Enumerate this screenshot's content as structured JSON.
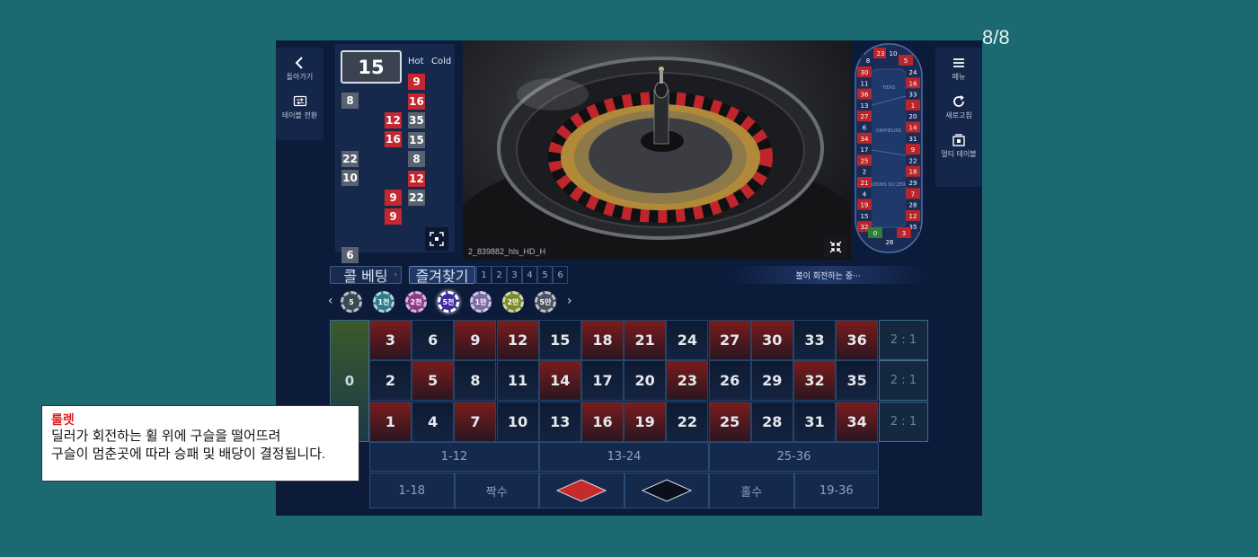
{
  "page_counter": "8/8",
  "left_menu": {
    "back_label": "돌아가기",
    "switch_label": "테이블 전환"
  },
  "right_menu": {
    "menu_label": "메뉴",
    "refresh_label": "새로고침",
    "multi_label": "멀티 테이블"
  },
  "history": {
    "last_result": "15",
    "hot_label": "Hot",
    "cold_label": "Cold",
    "results": [
      {
        "value": "8",
        "color": "gray",
        "col": 0,
        "row": 0
      },
      {
        "value": "12",
        "color": "red",
        "col": 2,
        "row": 1
      },
      {
        "value": "16",
        "color": "red",
        "col": 2,
        "row": 2
      },
      {
        "value": "22",
        "color": "gray",
        "col": 0,
        "row": 3
      },
      {
        "value": "10",
        "color": "gray",
        "col": 0,
        "row": 4
      },
      {
        "value": "9",
        "color": "red",
        "col": 2,
        "row": 5
      },
      {
        "value": "9",
        "color": "red",
        "col": 2,
        "row": 6
      },
      {
        "value": "6",
        "color": "gray",
        "col": 0,
        "row": 8
      }
    ],
    "hot_cold": [
      {
        "value": "9",
        "color": "red"
      },
      {
        "value": "16",
        "color": "red"
      },
      {
        "value": "35",
        "color": "gray"
      },
      {
        "value": "15",
        "color": "gray"
      },
      {
        "value": "8",
        "color": "gray"
      },
      {
        "value": "12",
        "color": "red"
      },
      {
        "value": "22",
        "color": "gray"
      }
    ]
  },
  "video": {
    "stream_label": "2_839882_hls_HD_H"
  },
  "racetrack": {
    "top": [
      "8",
      "23",
      "10",
      "5"
    ],
    "left": [
      "30",
      "11",
      "36",
      "13",
      "27",
      "6",
      "34",
      "17",
      "25",
      "2",
      "21",
      "4",
      "19",
      "15",
      "32"
    ],
    "right": [
      "24",
      "16",
      "33",
      "1",
      "20",
      "14",
      "31",
      "9",
      "22",
      "18",
      "29",
      "7",
      "28",
      "12",
      "35"
    ],
    "bottom": [
      "0",
      "26",
      "3"
    ],
    "sections": [
      "TIERS",
      "ORPHELINS",
      "VOISINS DU ZERO"
    ]
  },
  "controls": {
    "call_bet_label": "콜 베팅",
    "favorites_label": "즐겨찾기",
    "favorite_slots": [
      "1",
      "2",
      "3",
      "4",
      "5",
      "6"
    ],
    "status_text": "볼이 회전하는 중···"
  },
  "chips": [
    {
      "label": "5",
      "color": "#3a4a52"
    },
    {
      "label": "1천",
      "color": "#2b7d8a"
    },
    {
      "label": "2천",
      "color": "#8a3b8a"
    },
    {
      "label": "5천",
      "color": "#3f2a9a"
    },
    {
      "label": "1만",
      "color": "#7c6aa8"
    },
    {
      "label": "2만",
      "color": "#7c8a2a"
    },
    {
      "label": "5만",
      "color": "#4a5260"
    }
  ],
  "table": {
    "zero": "0",
    "rows": [
      [
        {
          "n": "3",
          "c": "red"
        },
        {
          "n": "6",
          "c": "black"
        },
        {
          "n": "9",
          "c": "red"
        },
        {
          "n": "12",
          "c": "red"
        },
        {
          "n": "15",
          "c": "black"
        },
        {
          "n": "18",
          "c": "red"
        },
        {
          "n": "21",
          "c": "red"
        },
        {
          "n": "24",
          "c": "black"
        },
        {
          "n": "27",
          "c": "red"
        },
        {
          "n": "30",
          "c": "red"
        },
        {
          "n": "33",
          "c": "black"
        },
        {
          "n": "36",
          "c": "red"
        }
      ],
      [
        {
          "n": "2",
          "c": "black"
        },
        {
          "n": "5",
          "c": "red"
        },
        {
          "n": "8",
          "c": "black"
        },
        {
          "n": "11",
          "c": "black"
        },
        {
          "n": "14",
          "c": "red"
        },
        {
          "n": "17",
          "c": "black"
        },
        {
          "n": "20",
          "c": "black"
        },
        {
          "n": "23",
          "c": "red"
        },
        {
          "n": "26",
          "c": "black"
        },
        {
          "n": "29",
          "c": "black"
        },
        {
          "n": "32",
          "c": "red"
        },
        {
          "n": "35",
          "c": "black"
        }
      ],
      [
        {
          "n": "1",
          "c": "red"
        },
        {
          "n": "4",
          "c": "black"
        },
        {
          "n": "7",
          "c": "red"
        },
        {
          "n": "10",
          "c": "black"
        },
        {
          "n": "13",
          "c": "black"
        },
        {
          "n": "16",
          "c": "red"
        },
        {
          "n": "19",
          "c": "red"
        },
        {
          "n": "22",
          "c": "black"
        },
        {
          "n": "25",
          "c": "red"
        },
        {
          "n": "28",
          "c": "black"
        },
        {
          "n": "31",
          "c": "black"
        },
        {
          "n": "34",
          "c": "red"
        }
      ]
    ],
    "columns": [
      "2 : 1",
      "2 : 1",
      "2 : 1"
    ],
    "dozens": [
      "1-12",
      "13-24",
      "25-36"
    ],
    "low": "1-18",
    "even": "짝수",
    "odd": "홀수",
    "high": "19-36",
    "colors": {
      "red": "#c62a2a",
      "black": "#0a0f1c"
    }
  },
  "tooltip": {
    "title": "룰렛",
    "line1": "딜러가 회전하는 휠 위에 구슬을 떨어뜨려",
    "line2": "구슬이 멈춘곳에 따라 승패 및 배당이 결정됩니다."
  }
}
